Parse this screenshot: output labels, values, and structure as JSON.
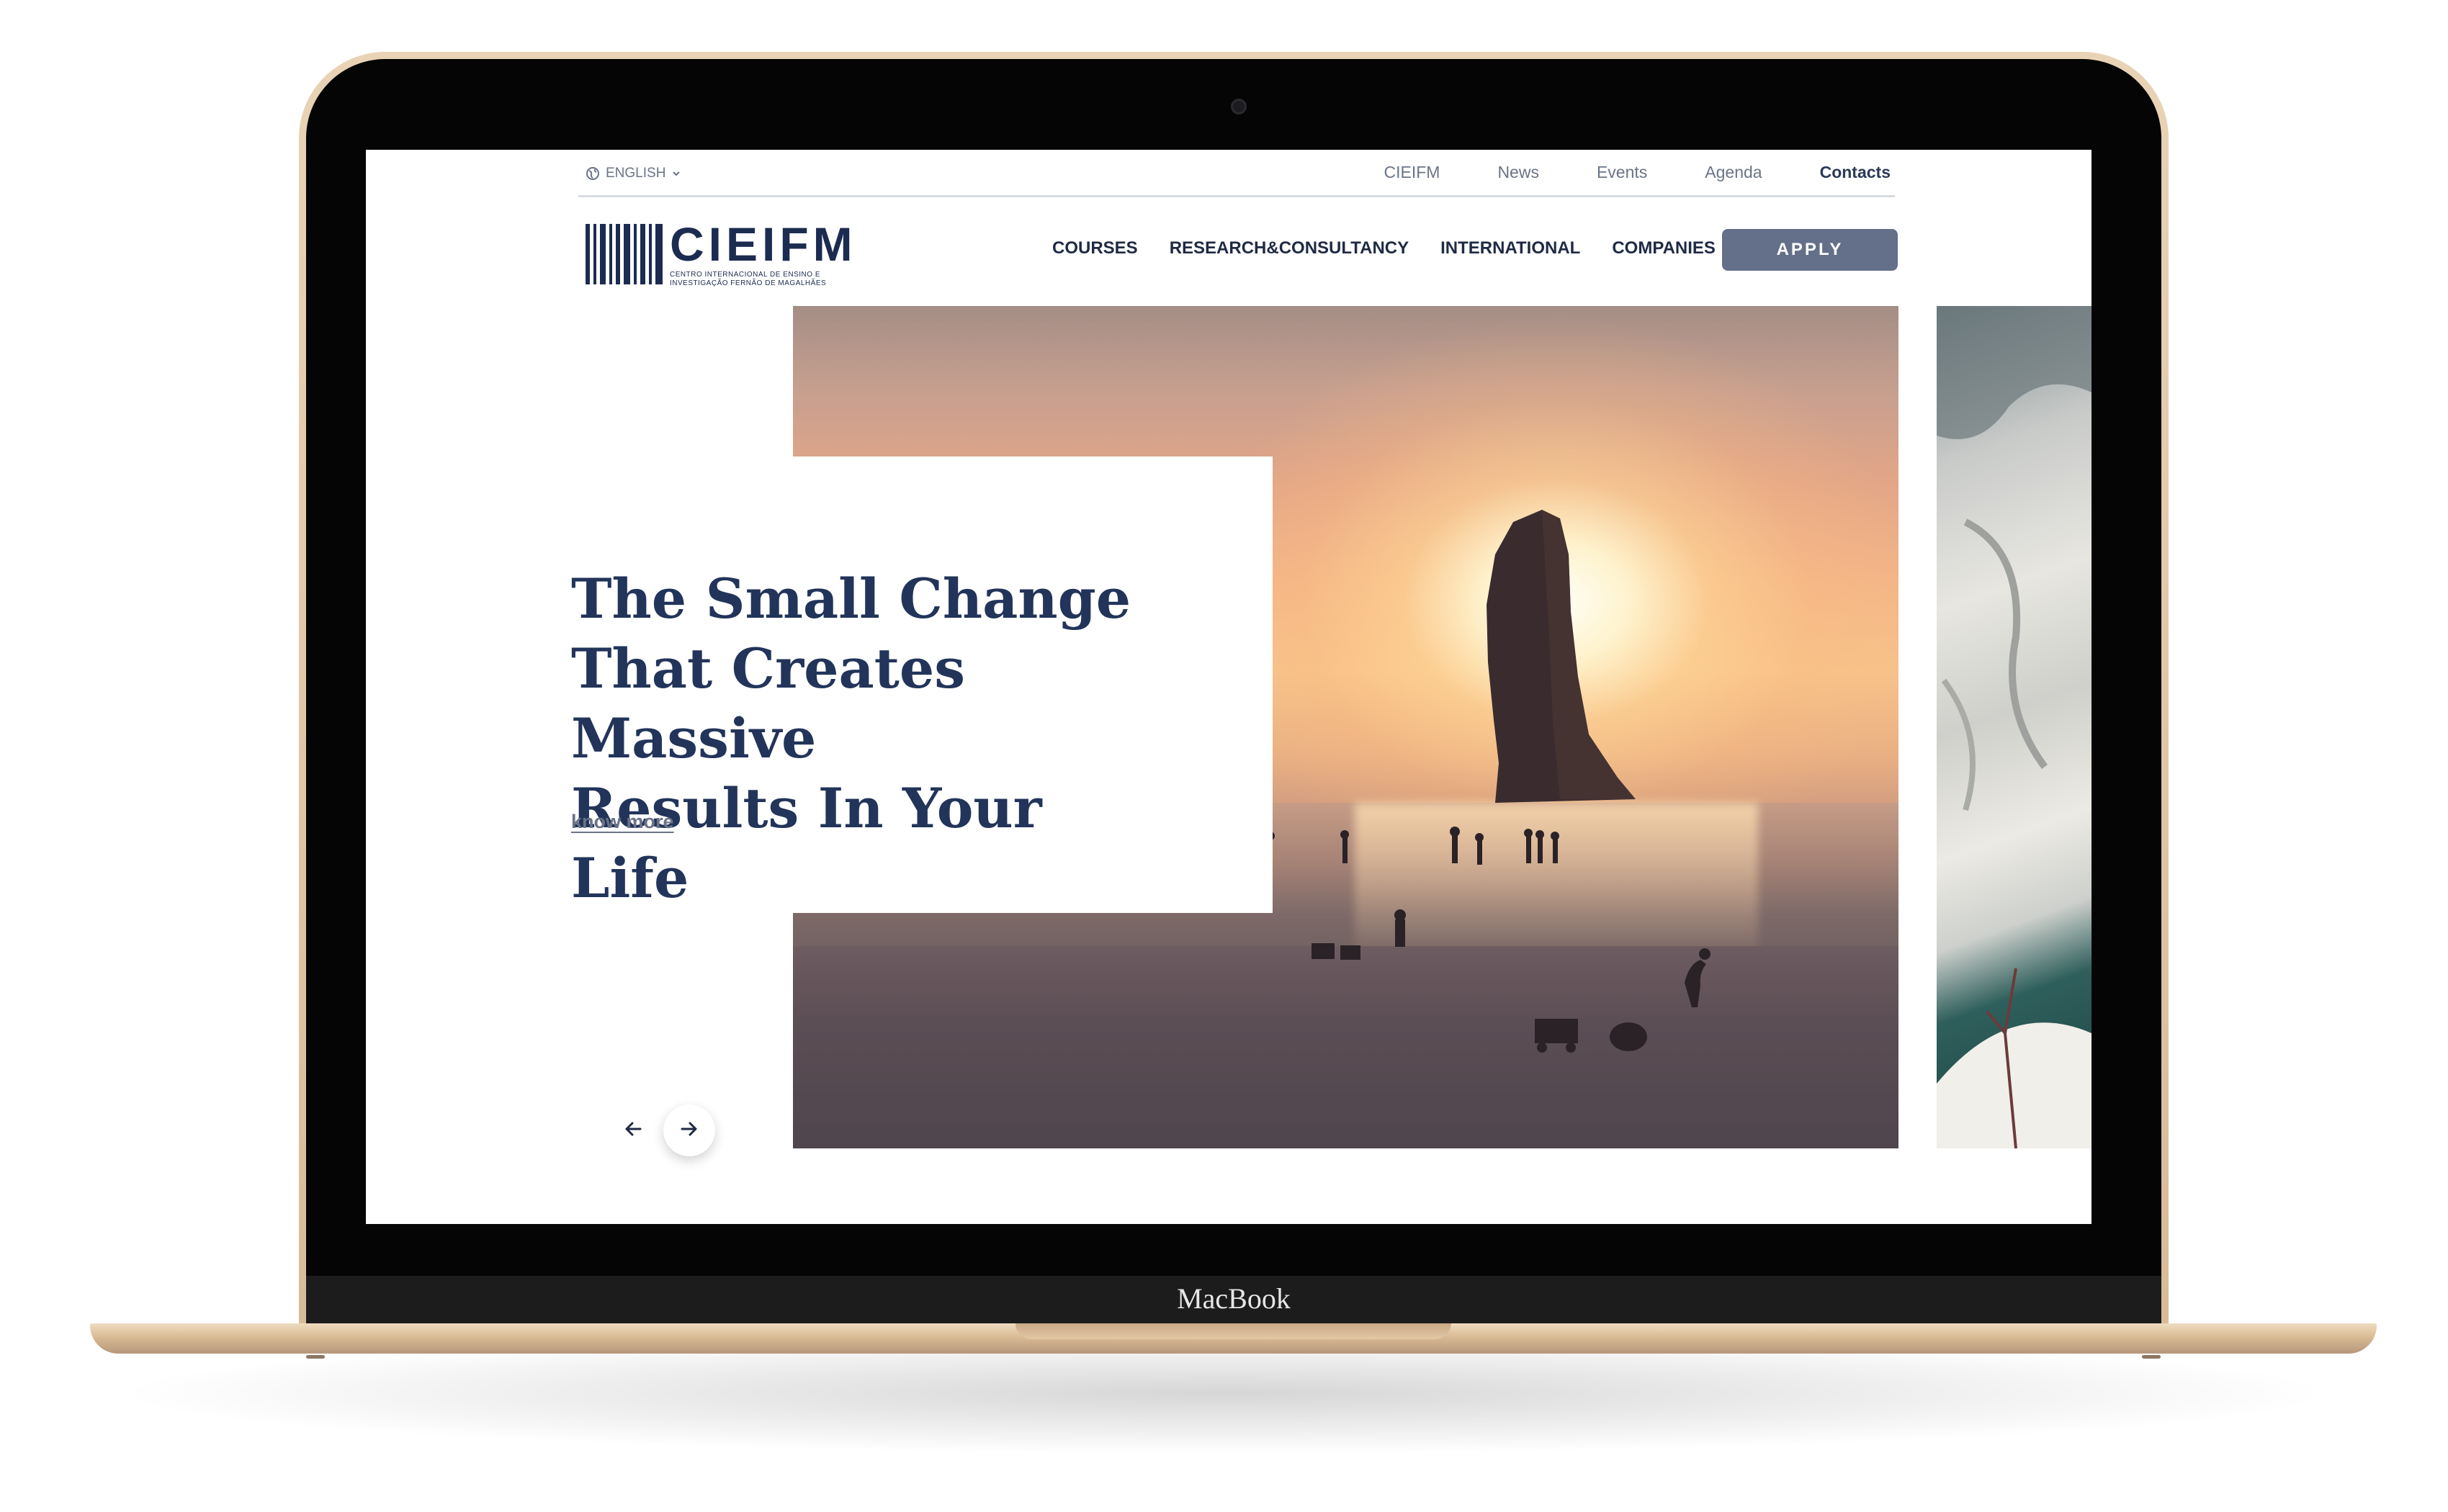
{
  "device": {
    "brand_label": "MacBook"
  },
  "topbar": {
    "language": "ENGLISH",
    "links": [
      "CIEIFM",
      "News",
      "Events",
      "Agenda",
      "Contacts"
    ],
    "active_link": "Contacts"
  },
  "logo": {
    "name": "CIEIFM",
    "subtitle_line1": "CENTRO INTERNACIONAL DE ENSINO E",
    "subtitle_line2": "INVESTIGAÇÃO FERNÃO DE MAGALHÃES"
  },
  "nav": {
    "items": [
      "COURSES",
      "RESEARCH&CONSULTANCY",
      "INTERNATIONAL",
      "COMPANIES"
    ],
    "apply_label": "APPLY"
  },
  "hero": {
    "title_line1": "The Small Change",
    "title_line2": "That Creates Massive",
    "title_line3": "Results In Your Life",
    "link_label": "know more",
    "prev_icon": "arrow-left-icon",
    "next_icon": "arrow-right-icon"
  },
  "colors": {
    "brand_navy": "#1c2b50",
    "title_navy": "#22345a",
    "button_slate": "#64708a",
    "muted_text": "#6b7486"
  }
}
